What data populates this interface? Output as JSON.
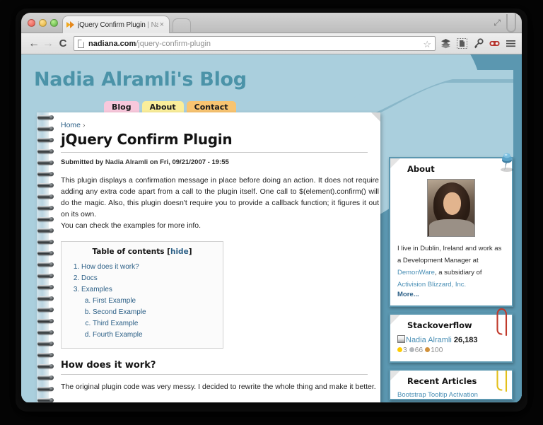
{
  "browser": {
    "tab": {
      "title_main": "jQuery Confirm Plugin",
      "title_sep": " | Nad",
      "close": "×",
      "favicon": "jquery-favicon"
    },
    "new_tab_label": "",
    "expand_icon": "⤢",
    "nav": {
      "back": "←",
      "forward": "→",
      "reload": "C"
    },
    "omnibox": {
      "domain": "nadiana.com",
      "path": "/jquery-confirm-plugin",
      "star": "☆"
    },
    "toolbar_icons": [
      "layers-icon",
      "extension-icon",
      "key-icon",
      "mask-icon",
      "menu-icon"
    ]
  },
  "site": {
    "title": "Nadia Alramli's Blog",
    "nav": [
      {
        "label": "Blog",
        "color": "#f8c8dc"
      },
      {
        "label": "About",
        "color": "#faee9a"
      },
      {
        "label": "Contact",
        "color": "#f8c471"
      }
    ],
    "colors": {
      "bg_light": "#aacfdd",
      "bg_dark": "#5b97b0",
      "title": "#4b93a8",
      "link": "#2b5f86"
    }
  },
  "post": {
    "breadcrumb": "Home",
    "breadcrumb_sep": "›",
    "title": "jQuery Confirm Plugin",
    "submitted_prefix": "Submitted by ",
    "submitted_author": "Nadia Alramli",
    "submitted_suffix": " on Fri, 09/21/2007 - 19:55",
    "paragraph1": "This plugin displays a confirmation message in place before doing an action. It does not require adding any extra code apart from a call to the plugin itself. One call to $(element).confirm() will do the magic. Also, this plugin doesn't require you to provide a callback function; it figures it out on its own.",
    "paragraph2": "You can check the examples for more info.",
    "toc": {
      "title": "Table of contents",
      "hide_open": "[",
      "hide_label": "hide",
      "hide_close": "]",
      "items": [
        {
          "label": "How does it work?"
        },
        {
          "label": "Docs"
        },
        {
          "label": "Examples",
          "children": [
            {
              "label": "First Example"
            },
            {
              "label": "Second Example"
            },
            {
              "label": "Third Example"
            },
            {
              "label": "Fourth Example"
            }
          ]
        }
      ]
    },
    "section_heading": "How does it work?",
    "clipped_text": "The original plugin code was very messy. I decided to rewrite the whole thing and make it better."
  },
  "sidebar": {
    "about": {
      "title": "About",
      "avatar_alt": "nadia-avatar",
      "text_1": "I live in Dublin, Ireland and work as a Development Manager at ",
      "link_1": "DemonWare",
      "text_2": ", a subsidiary of ",
      "link_2": "Activision Blizzard, Inc.",
      "more": "More..."
    },
    "stackoverflow": {
      "title": "Stackoverflow",
      "user": "Nadia Alramli",
      "reputation": "26,183",
      "badges": {
        "gold": "3",
        "silver": "66",
        "bronze": "100",
        "gold_color": "#ffcc00",
        "silver_color": "#b4b8bc",
        "bronze_color": "#d1913c"
      }
    },
    "recent_articles": {
      "title": "Recent Articles",
      "first_item": "Bootstrap Tooltip Activation"
    }
  }
}
